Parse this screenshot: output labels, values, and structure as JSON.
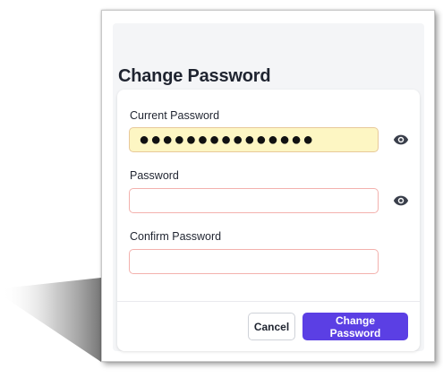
{
  "dialog": {
    "title": "Change Password"
  },
  "fields": {
    "current_password": {
      "label": "Current Password",
      "value": "●●●●●●●●●●●●●●●"
    },
    "password": {
      "label": "Password",
      "value": ""
    },
    "confirm_password": {
      "label": "Confirm Password",
      "value": ""
    }
  },
  "actions": {
    "cancel_label": "Cancel",
    "submit_label": "Change Password"
  },
  "icons": {
    "reveal_password": "eye-icon"
  },
  "colors": {
    "primary": "#5b3fe4",
    "filled_field_bg": "#fdf6c3",
    "invalid_border": "#f3b1ad",
    "panel_bg": "#f4f5f7"
  }
}
